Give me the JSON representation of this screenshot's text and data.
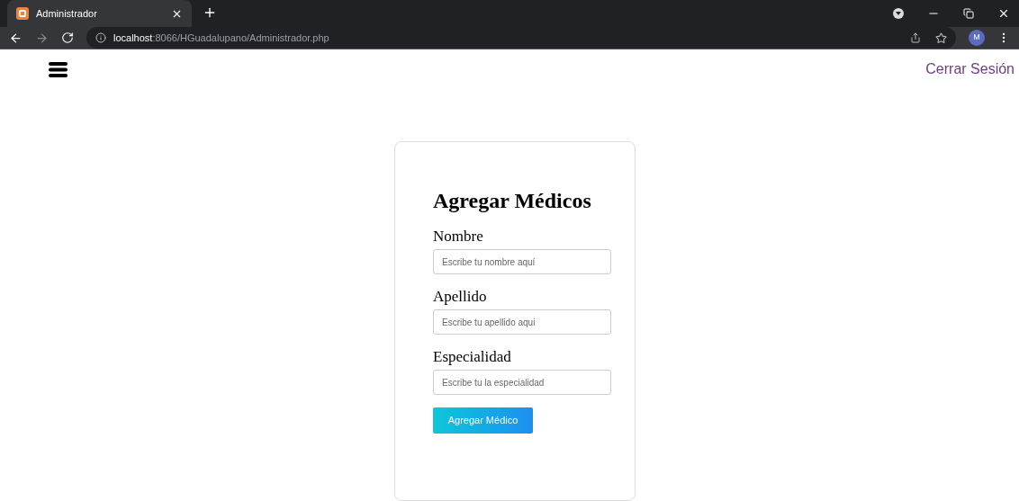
{
  "browser": {
    "tab": {
      "title": "Administrador",
      "selected": true
    },
    "url": "**localhost**:8066/HGuadalupano/Administrador.php",
    "avatar": "M"
  },
  "header": {
    "logout": "Cerrar Sesión"
  },
  "form": {
    "title": "Agregar Médicos",
    "fields": [
      {
        "label": "Nombre",
        "placeholder": "Escribe tu nombre aquí"
      },
      {
        "label": "Apellido",
        "placeholder": "Escribe tu apellido aqui"
      },
      {
        "label": "Especialidad",
        "placeholder": "Escribe tu la especialidad"
      }
    ],
    "submit": "Agregar Médico"
  }
}
